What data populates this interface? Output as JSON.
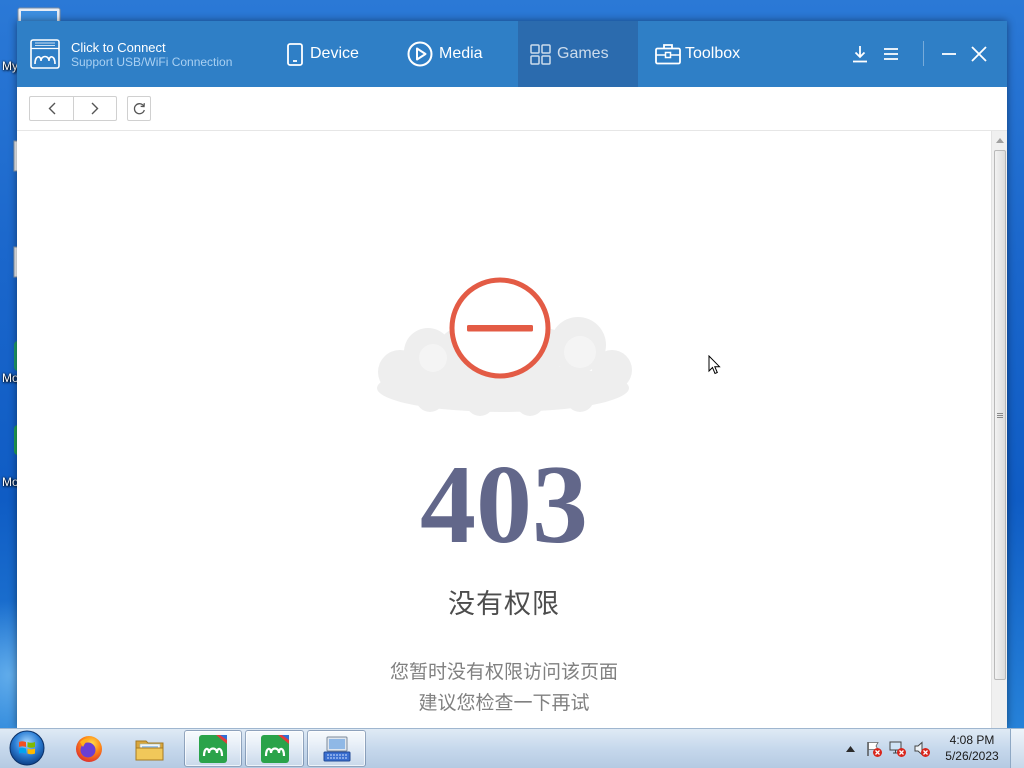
{
  "desktop": {
    "icons": [
      {
        "icon": "computer-icon",
        "label": "My"
      },
      {
        "icon": "file-icon"
      },
      {
        "icon": "file-icon"
      },
      {
        "icon": "app-icon",
        "label": "Mo"
      },
      {
        "icon": "app-icon",
        "label": "Mo"
      }
    ]
  },
  "app": {
    "colors": {
      "header": "#2f7fc6",
      "active_tab": "#2b6bae",
      "active_text": "#cddcec",
      "error_red": "#e35b45",
      "code": "#62678a"
    },
    "connect": {
      "icon": "device-connect-icon",
      "title": "Click to Connect",
      "subtitle": "Support USB/WiFi Connection"
    },
    "tabs": [
      {
        "label": "Device",
        "icon": "phone-icon",
        "active": false
      },
      {
        "label": "Media",
        "icon": "play-circle-icon",
        "active": false
      },
      {
        "label": "Games",
        "icon": "grid-icon",
        "active": true
      },
      {
        "label": "Toolbox",
        "icon": "toolbox-icon",
        "active": false
      }
    ],
    "window_controls": [
      {
        "icon": "download-icon"
      },
      {
        "icon": "menu-icon"
      },
      {
        "icon": "minimize-icon"
      },
      {
        "icon": "close-icon"
      }
    ],
    "browser_nav": {
      "back_icon": "chevron-left-icon",
      "forward_icon": "chevron-right-icon",
      "refresh_icon": "refresh-icon"
    },
    "error_page": {
      "illustration": "forbidden-cloud-icon",
      "code": "403",
      "title": "没有权限",
      "messages": [
        "您暂时没有权限访问该页面",
        "建议您检查一下再试"
      ]
    }
  },
  "taskbar": {
    "start_icon": "windows-start-icon",
    "items": [
      {
        "icon": "firefox-icon",
        "open": false
      },
      {
        "icon": "folder-icon",
        "open": false
      },
      {
        "icon": "app-icon",
        "open": true
      },
      {
        "icon": "app-icon",
        "open": true
      },
      {
        "icon": "keyboard-app-icon",
        "open": true
      }
    ],
    "tray": {
      "icons": [
        "show-hidden-icons-icon",
        "action-center-alert-icon",
        "network-disconnected-icon",
        "volume-muted-icon"
      ],
      "time": "4:08 PM",
      "date": "5/26/2023"
    }
  }
}
